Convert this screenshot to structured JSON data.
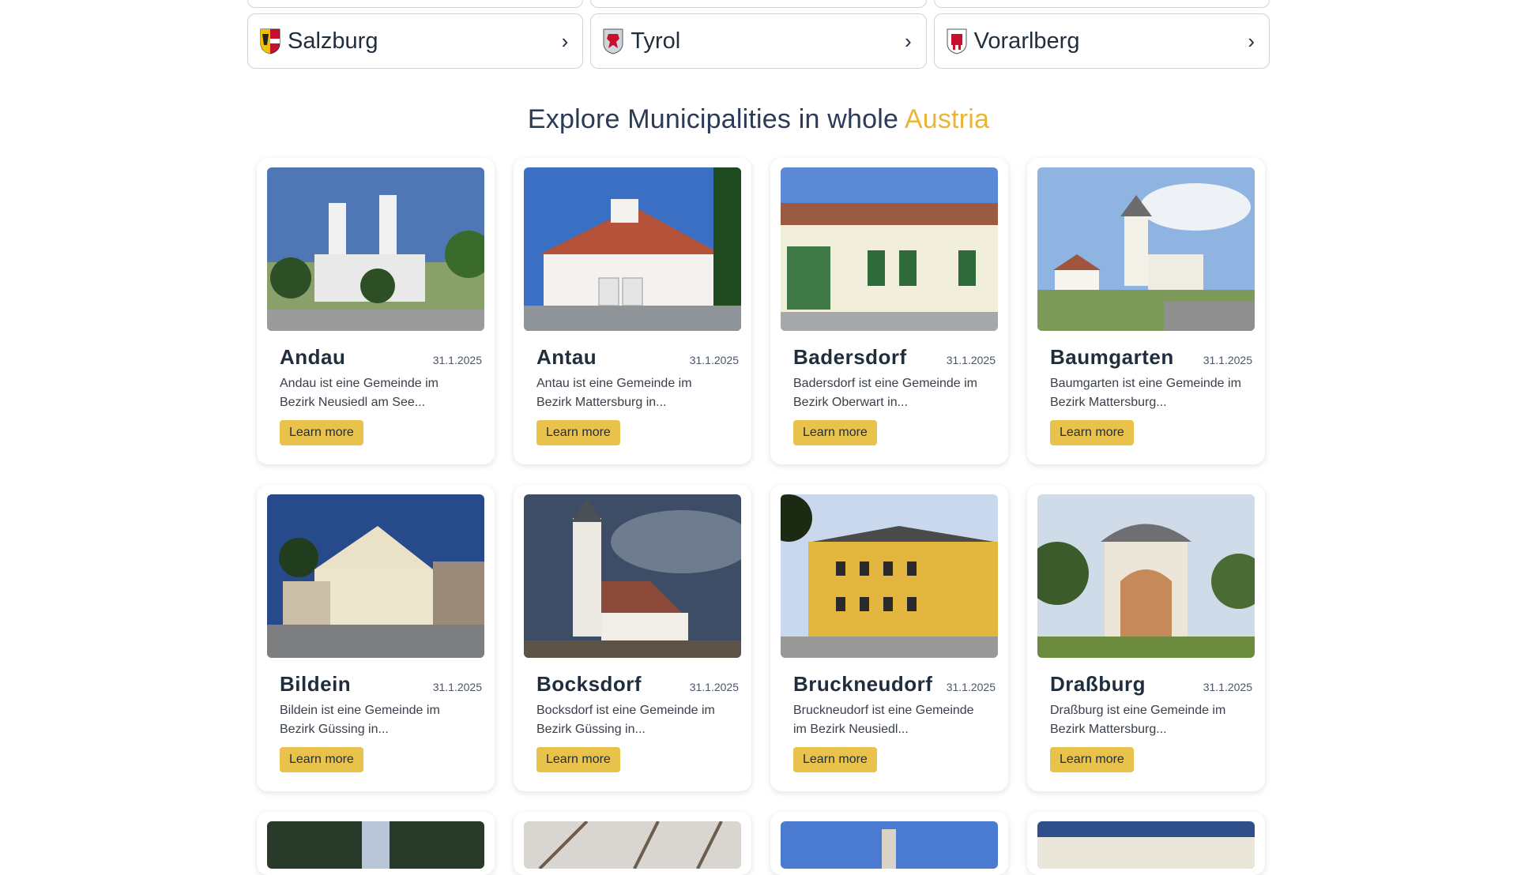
{
  "regions": [
    {
      "name": "Salzburg",
      "flag": "salzburg-coat-of-arms"
    },
    {
      "name": "Tyrol",
      "flag": "tyrol-coat-of-arms"
    },
    {
      "name": "Vorarlberg",
      "flag": "vorarlberg-coat-of-arms"
    }
  ],
  "section": {
    "title_prefix": "Explore Municipalities in whole",
    "title_accent": "Austria"
  },
  "municipalities": [
    {
      "name": "Andau",
      "date": "31.1.2025",
      "desc": "Andau ist eine Gemeinde im Bezirk Neusiedl am See...",
      "button": "Learn more"
    },
    {
      "name": "Antau",
      "date": "31.1.2025",
      "desc": "Antau ist eine Gemeinde im Bezirk Mattersburg in...",
      "button": "Learn more"
    },
    {
      "name": "Badersdorf",
      "date": "31.1.2025",
      "desc": "Badersdorf ist eine Gemeinde im Bezirk Oberwart in...",
      "button": "Learn more"
    },
    {
      "name": "Baumgarten",
      "date": "31.1.2025",
      "desc": "Baumgarten ist eine Gemeinde im Bezirk Mattersburg...",
      "button": "Learn more"
    },
    {
      "name": "Bildein",
      "date": "31.1.2025",
      "desc": "Bildein ist eine Gemeinde im Bezirk Güssing in...",
      "button": "Learn more"
    },
    {
      "name": "Bocksdorf",
      "date": "31.1.2025",
      "desc": "Bocksdorf ist eine Gemeinde im Bezirk Güssing in...",
      "button": "Learn more"
    },
    {
      "name": "Bruckneudorf",
      "date": "31.1.2025",
      "desc": "Bruckneudorf ist eine Gemeinde im Bezirk Neusiedl...",
      "button": "Learn more"
    },
    {
      "name": "Draßburg",
      "date": "31.1.2025",
      "desc": "Draßburg ist eine Gemeinde im Bezirk Mattersburg...",
      "button": "Learn more"
    }
  ],
  "colors": {
    "accent": "#e8b634",
    "button": "#e8c24a",
    "text": "#1f2d3d"
  }
}
